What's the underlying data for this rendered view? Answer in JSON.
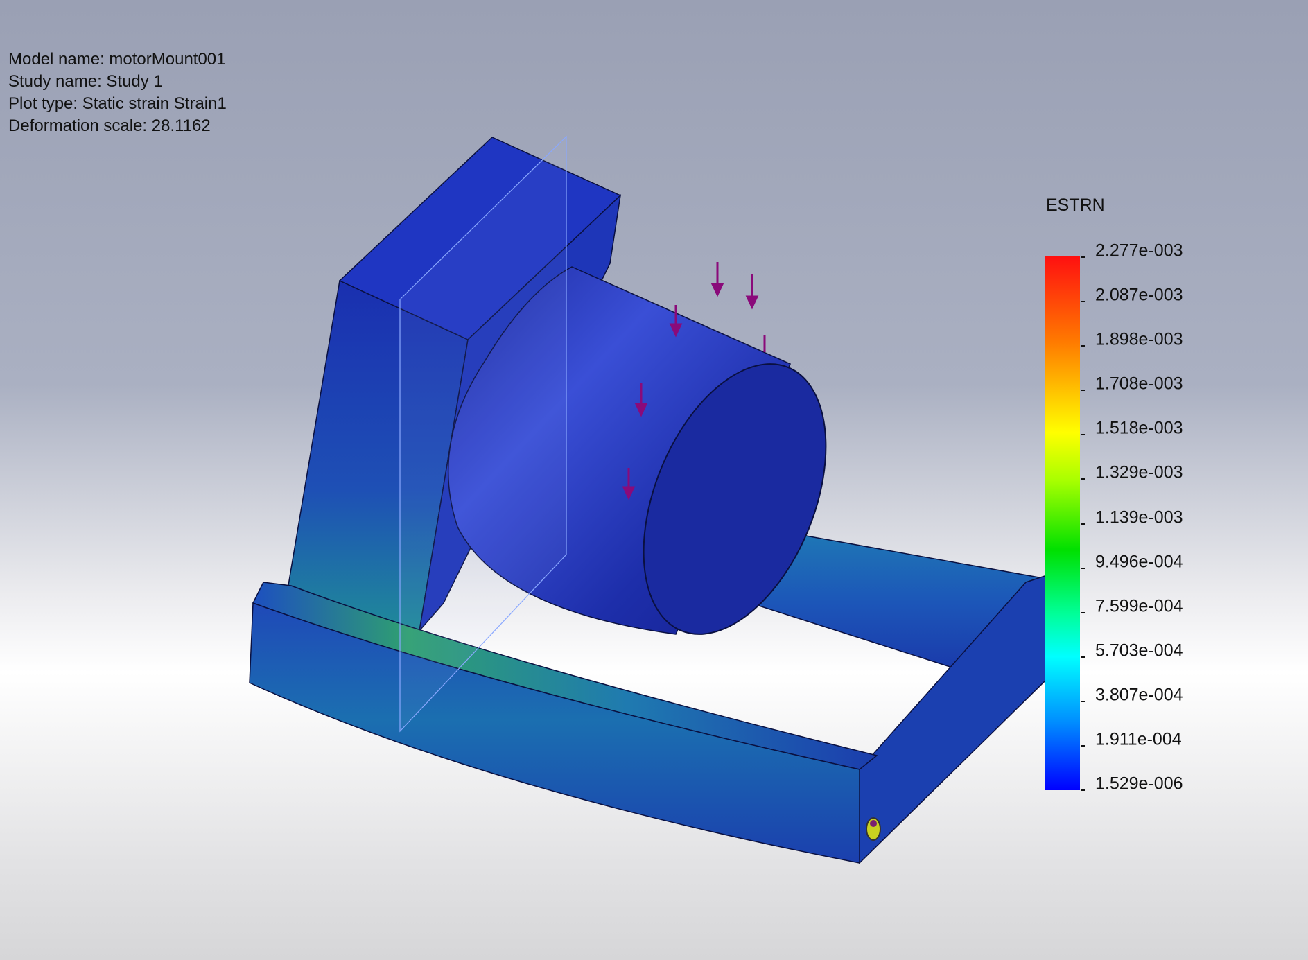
{
  "info": {
    "model_name": "Model name: motorMount001",
    "study_name": "Study name: Study 1",
    "plot_type": "Plot type: Static strain Strain1",
    "deformation_scale": "Deformation scale: 28.1162"
  },
  "legend": {
    "title": "ESTRN",
    "labels": [
      "2.277e-003",
      "2.087e-003",
      "1.898e-003",
      "1.708e-003",
      "1.518e-003",
      "1.329e-003",
      "1.139e-003",
      "9.496e-004",
      "7.599e-004",
      "5.703e-004",
      "3.807e-004",
      "1.911e-004",
      "1.529e-006"
    ]
  },
  "colors": {
    "model_blue": "#1e2fa8",
    "load_arrow": "#8a0a7a"
  },
  "icons": {
    "load_arrows": "down-arrow",
    "fixture": "fixture-marker-icon"
  }
}
